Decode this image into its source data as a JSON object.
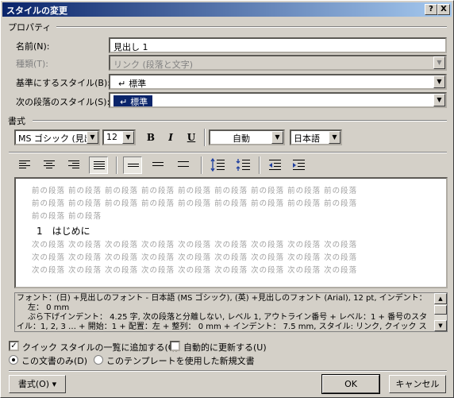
{
  "title": "スタイルの変更",
  "titlebar_buttons": {
    "help": "?",
    "close": "X"
  },
  "properties": {
    "section_title": "プロパティ",
    "name_label": "名前(N):",
    "name_value": "見出し 1",
    "type_label": "種類(T):",
    "type_value": "リンク (段落と文字)",
    "base_label": "基準にするスタイル(B):",
    "base_value": "標準",
    "base_icon": "↵",
    "next_label": "次の段落のスタイル(S):",
    "next_value": "標準",
    "next_icon": "↵"
  },
  "format": {
    "section_title": "書式",
    "font": "MS ゴシック (見出",
    "size": "12",
    "bold": "B",
    "italic": "I",
    "underline": "U",
    "color": "自動",
    "language": "日本語"
  },
  "preview": {
    "prev_lines": [
      "前の段落 前の段落 前の段落 前の段落 前の段落 前の段落 前の段落 前の段落 前の段落",
      "前の段落 前の段落 前の段落 前の段落 前の段落 前の段落 前の段落 前の段落 前の段落",
      "前の段落 前の段落"
    ],
    "main_text": "1　はじめに",
    "next_lines": [
      "次の段落 次の段落 次の段落 次の段落 次の段落 次の段落 次の段落 次の段落 次の段落",
      "次の段落 次の段落 次の段落 次の段落 次の段落 次の段落 次の段落 次の段落 次の段落",
      "次の段落 次の段落 次の段落 次の段落 次の段落 次の段落 次の段落 次の段落 次の段落"
    ]
  },
  "description": [
    "フォント：(日) +見出しのフォント - 日本語 (MS ゴシック), (英) +見出しのフォント (Arial), 12 pt, インデント：",
    "左：  0 mm",
    "ぶら下げインデント：  4.25 字, 次の段落と分離しない, レベル 1, アウトライン番号 + レベル：1 + 番号のスタ",
    "イル：1, 2, 3 … + 開始：1 + 配置：左 + 整列：  0 mm + インデント：  7.5 mm, スタイル: リンク, クイック スタ"
  ],
  "options": {
    "add_to_quick": "クイック スタイルの一覧に追加する(Q)",
    "add_to_quick_checked": true,
    "auto_update": "自動的に更新する(U)",
    "auto_update_checked": false,
    "this_doc_only": "この文書のみ(D)",
    "new_docs": "このテンプレートを使用した新規文書"
  },
  "buttons": {
    "format": "書式(O) ▾",
    "ok": "OK",
    "cancel": "キャンセル"
  },
  "colors": {
    "title_start": "#0a246a",
    "title_end": "#a6caf0",
    "selection": "#0a246a"
  }
}
